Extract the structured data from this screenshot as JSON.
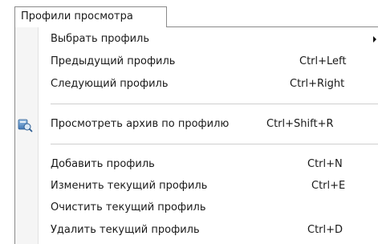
{
  "menubar": {
    "title": "Профили просмотра"
  },
  "menu": {
    "items": [
      {
        "label": "Выбрать профиль",
        "shortcut": "",
        "has_submenu": true
      },
      {
        "label": "Предыдущий профиль",
        "shortcut": "Ctrl+Left"
      },
      {
        "label": "Следующий профиль",
        "shortcut": "Ctrl+Right"
      },
      {
        "label": "Просмотреть архив по профилю",
        "shortcut": "Ctrl+Shift+R",
        "icon": "archive-view-icon"
      },
      {
        "label": "Добавить профиль",
        "shortcut": "Ctrl+N"
      },
      {
        "label": "Изменить текущий профиль",
        "shortcut": "Ctrl+E"
      },
      {
        "label": "Очистить текущий профиль",
        "shortcut": ""
      },
      {
        "label": "Удалить текущий профиль",
        "shortcut": "Ctrl+D"
      }
    ]
  }
}
